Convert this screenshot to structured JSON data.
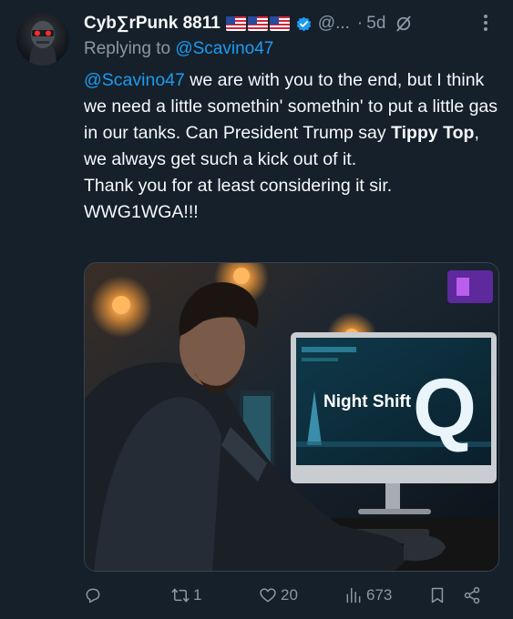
{
  "tweet": {
    "display_name": "Cyb∑rPunk 8811",
    "handle": "@...",
    "separator": "·",
    "time": "5d",
    "replying_prefix": "Replying to ",
    "replying_to": "@Scavino47",
    "mention": "@Scavino47",
    "text_1": " we are with you to the end, but I think we need a little somethin' somethin' to put a little gas in our tanks. Can President Trump say ",
    "text_bold": "Tippy Top",
    "text_2": ", we always get such a kick out of it.",
    "text_line2": "Thank you for at least considering it sir.",
    "text_line3": "WWG1WGA!!!",
    "image_screen_text": "Night Shift",
    "image_q_letter": "Q"
  },
  "actions": {
    "reply_count": "",
    "retweet_count": "1",
    "like_count": "20",
    "views_count": "673"
  },
  "icons": [
    "grok-icon",
    "more-icon",
    "verified-badge-icon",
    "flag-us-icon",
    "reply-icon",
    "retweet-icon",
    "like-icon",
    "views-icon",
    "bookmark-icon",
    "share-icon"
  ],
  "colors": {
    "background": "#15202b",
    "link": "#1d9bf0",
    "muted": "#8b98a5",
    "verified": "#1d9bf0"
  }
}
